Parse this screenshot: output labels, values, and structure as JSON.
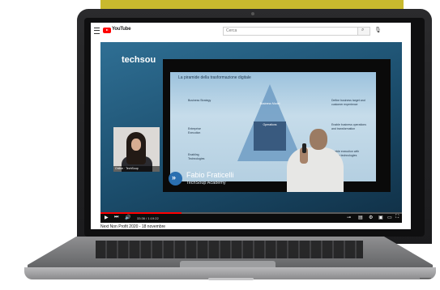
{
  "youtube": {
    "logo_text": "YouTube",
    "search_placeholder": "Cerca",
    "search_icon": "search-icon",
    "mic_icon": "mic-icon"
  },
  "video": {
    "brand_logo": "techsou",
    "slide_title": "La piramide della trasformazione digitale",
    "slide_labels": {
      "left_top": "Business Strategy",
      "left_mid": "Entreprise Execution",
      "left_bottom": "Enabling Technologies",
      "pyr_top": "Business Model",
      "pyr_mid": "Operations",
      "right_top": "Define business target and customer experience",
      "right_mid": "Enable business operations and transformation",
      "right_bottom": "Enable execution with proven technologies"
    },
    "speaker_name": "Fabio Fraticelli",
    "speaker_org": "TechSoup Academy",
    "webcam_label": "Online · TechSoup",
    "current_time": "33:36 / 1:19:22",
    "progress": 0.27
  },
  "page": {
    "video_title": "Next Non Profit 2020 - 18 novembre"
  },
  "colors": {
    "youtube_red": "#ff0000",
    "video_bg": "#1b4d6c",
    "banner": "#c8b92e"
  }
}
